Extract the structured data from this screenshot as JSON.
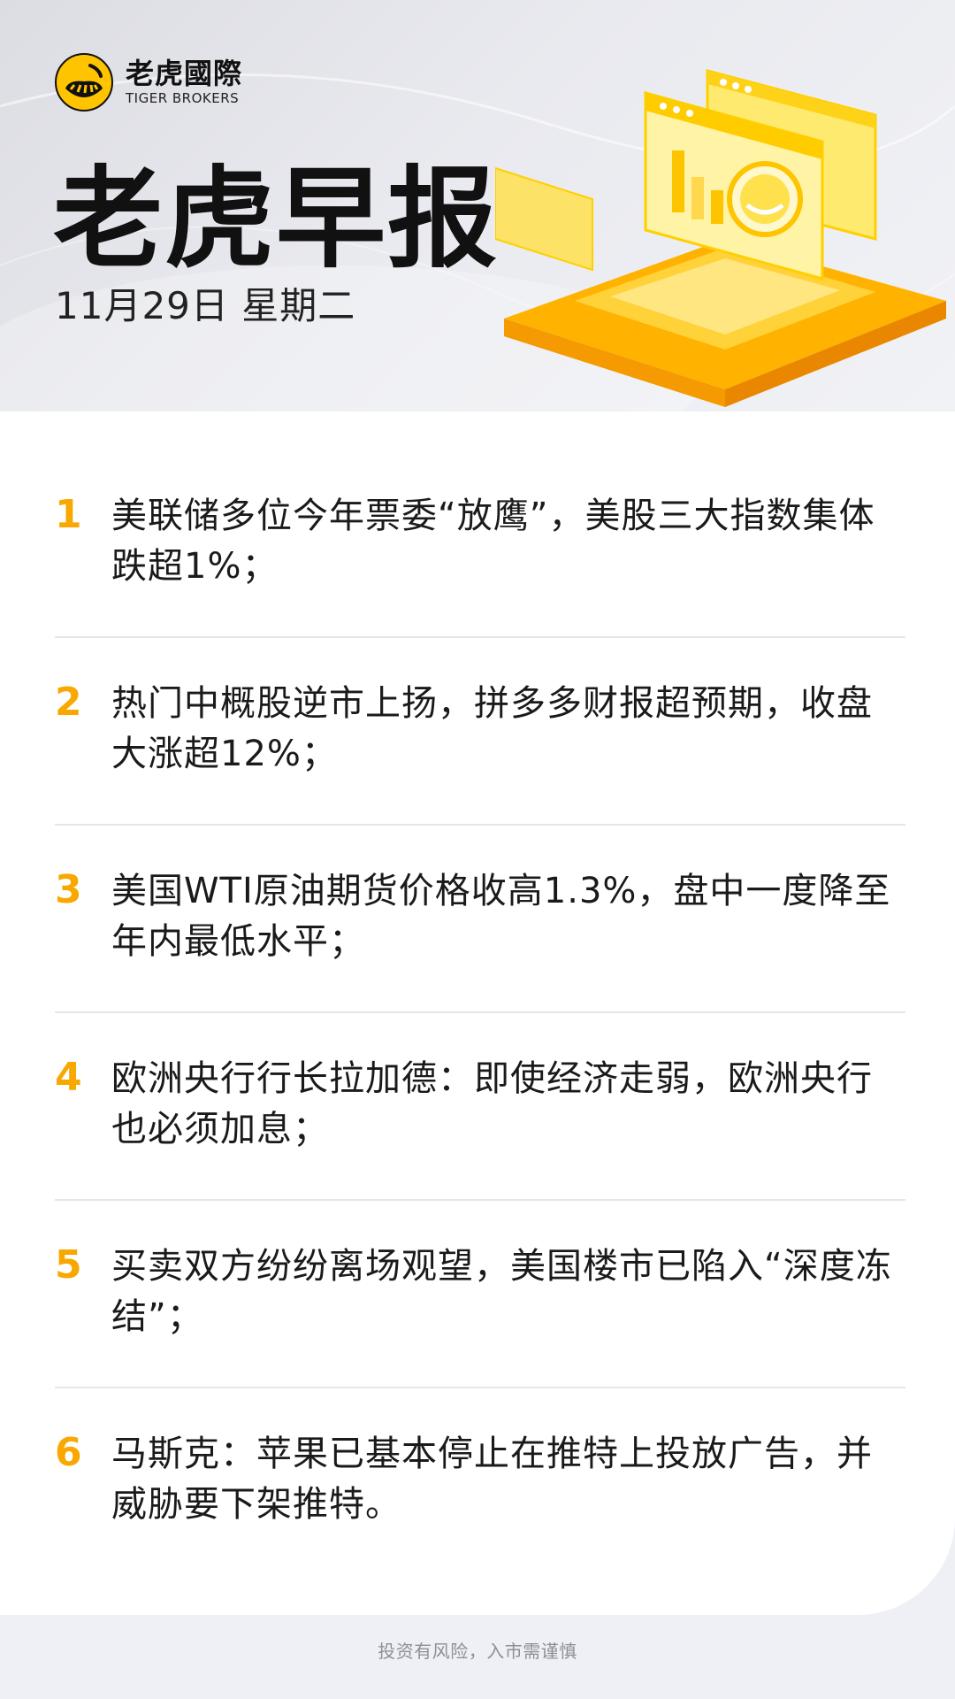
{
  "brand": {
    "name_cn": "老虎國際",
    "name_en": "TIGER BROKERS"
  },
  "title": "老虎早报",
  "date": "11月29日 星期二",
  "accent_color": "#f8a800",
  "news": [
    {
      "number": "1",
      "text": "美联储多位今年票委“放鹰”，美股三大指数集体跌超1%；"
    },
    {
      "number": "2",
      "text": "热门中概股逆市上扬，拼多多财报超预期，收盘大涨超12%；"
    },
    {
      "number": "3",
      "text": "美国WTI原油期货价格收高1.3%，盘中一度降至年内最低水平；"
    },
    {
      "number": "4",
      "text": "欧洲央行行长拉加德：即使经济走弱，欧洲央行也必须加息；"
    },
    {
      "number": "5",
      "text": "买卖双方纷纷离场观望，美国楼市已陷入“深度冻结”；"
    },
    {
      "number": "6",
      "text": "马斯克：苹果已基本停止在推特上投放广告，并威胁要下架推特。"
    }
  ],
  "footer": "投资有风险，入市需谨慎"
}
